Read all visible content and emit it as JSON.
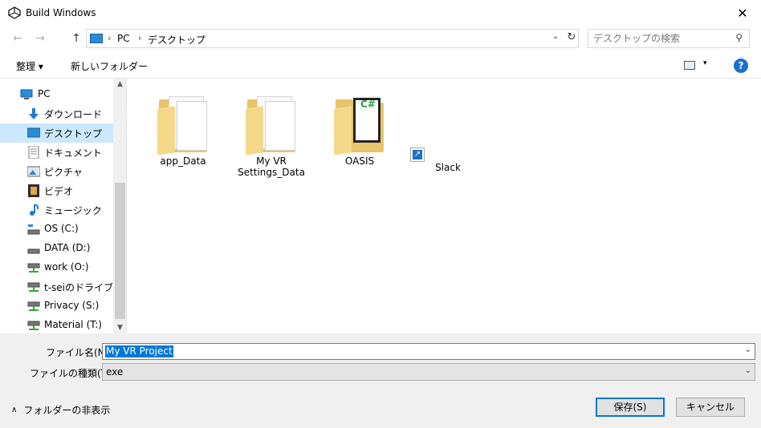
{
  "window": {
    "title": "Build Windows",
    "app_icon": "unity-icon",
    "close_glyph": "✕"
  },
  "nav_buttons": {
    "back_glyph": "←",
    "forward_glyph": "→",
    "up_glyph": "↑"
  },
  "address": {
    "segments": [
      "PC",
      "デスクトップ"
    ],
    "separator_glyph": "›",
    "dropdown_glyph": "⌄",
    "refresh_glyph": "↻"
  },
  "search": {
    "placeholder": "デスクトップの検索",
    "icon_glyph": "⚲"
  },
  "toolbar": {
    "organize_label": "整理 ▾",
    "new_folder_label": "新しいフォルダー",
    "view_glyph": "▾",
    "help_glyph": "?"
  },
  "nav_pane": {
    "items": [
      {
        "label": "PC",
        "icon": "pc-icon"
      },
      {
        "label": "ダウンロード",
        "icon": "download-icon"
      },
      {
        "label": "デスクトップ",
        "icon": "desktop-icon",
        "selected": true
      },
      {
        "label": "ドキュメント",
        "icon": "document-icon"
      },
      {
        "label": "ピクチャ",
        "icon": "pictures-icon"
      },
      {
        "label": "ビデオ",
        "icon": "video-icon"
      },
      {
        "label": "ミュージック",
        "icon": "music-icon"
      },
      {
        "label": "OS (C:)",
        "icon": "drive-icon"
      },
      {
        "label": "DATA (D:)",
        "icon": "drive-icon"
      },
      {
        "label": "work (O:)",
        "icon": "network-drive-icon"
      },
      {
        "label": "t-seiのドライブ (P:)",
        "icon": "network-drive-icon"
      },
      {
        "label": "Privacy (S:)",
        "icon": "network-drive-icon"
      },
      {
        "label": "Material (T:)",
        "icon": "network-drive-icon"
      }
    ],
    "scroll_up_glyph": "▲",
    "scroll_down_glyph": "▼"
  },
  "files": [
    {
      "name": "app_Data",
      "type": "folder"
    },
    {
      "name": "My VR Settings_Data",
      "type": "folder"
    },
    {
      "name": "OASIS",
      "type": "folder-csharp",
      "badge": "C#"
    },
    {
      "name": "Slack",
      "type": "shortcut"
    }
  ],
  "form": {
    "filename_label": "ファイル名(N):",
    "filename_value": "My VR Project",
    "filetype_label": "ファイルの種類(T):",
    "filetype_value": "exe",
    "dropdown_glyph": "⌄",
    "hide_folders_label": "フォルダーの非表示",
    "hide_folders_glyph": "∧",
    "save_label": "保存(S)",
    "cancel_label": "キャンセル"
  },
  "colors": {
    "selection": "#cce8ff",
    "accent": "#0078d7",
    "panel": "#f0f0f0"
  }
}
